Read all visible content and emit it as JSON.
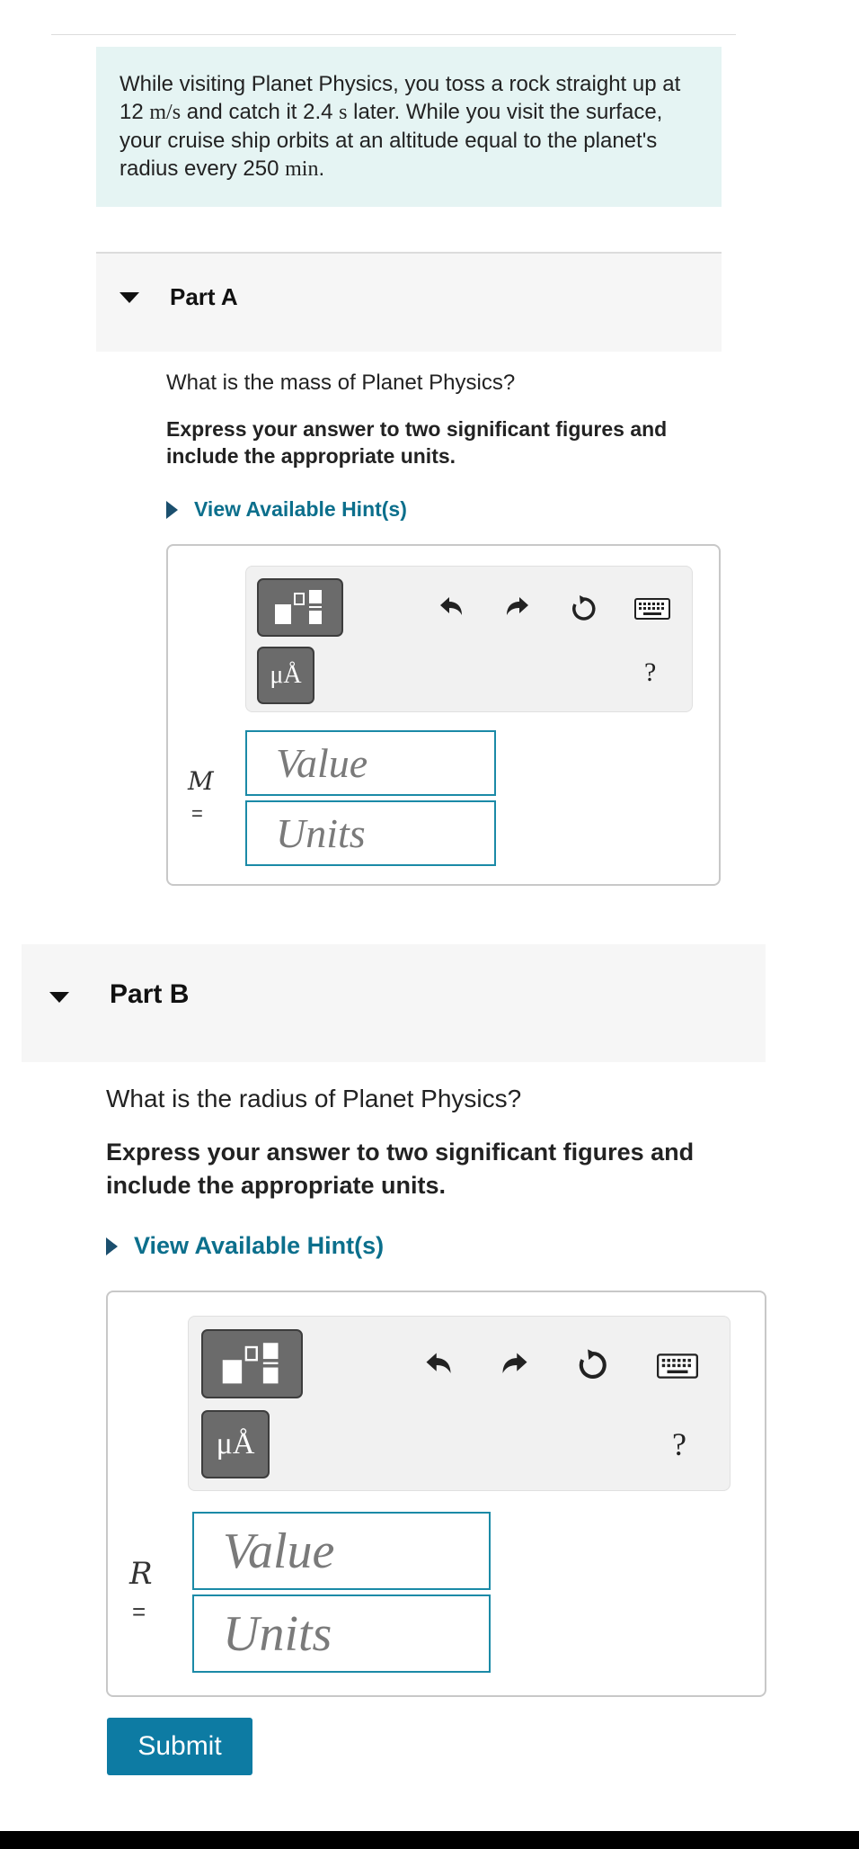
{
  "problem": {
    "text_a": "While visiting Planet Physics, you toss a rock straight up at 12 ",
    "unit_speed": "m/s",
    "text_b": " and catch it 2.4 ",
    "unit_time": "s",
    "text_c": " later. While you visit the surface, your cruise ship orbits at an altitude equal to the planet's radius every 250 ",
    "unit_period": "min",
    "text_d": "."
  },
  "partA": {
    "title": "Part A",
    "question": "What is the mass of Planet Physics?",
    "instructions": "Express your answer to two significant figures and include the appropriate units.",
    "hint": "View Available Hint(s)",
    "units_button": "μÅ",
    "help": "?",
    "variable": "M",
    "equals": "=",
    "value_placeholder": "Value",
    "units_placeholder": "Units"
  },
  "partB": {
    "title": "Part B",
    "question": "What is the radius of Planet Physics?",
    "instructions": "Express your answer to two significant figures and include the appropriate units.",
    "hint": "View Available Hint(s)",
    "units_button": "μÅ",
    "help": "?",
    "variable": "R",
    "equals": "=",
    "value_placeholder": "Value",
    "units_placeholder": "Units"
  },
  "submit_label": "Submit",
  "icons": [
    "template-icon",
    "undo-icon",
    "redo-icon",
    "reset-icon",
    "keyboard-icon",
    "collapse-caret-icon",
    "expand-triangle-icon"
  ]
}
